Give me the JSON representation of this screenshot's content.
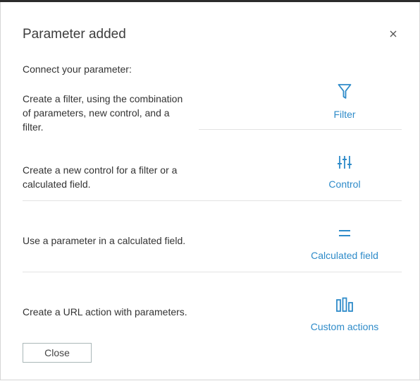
{
  "dialog": {
    "title": "Parameter added",
    "close_icon": "close-icon",
    "subtitle": "Connect your parameter:",
    "close_button_label": "Close"
  },
  "options": [
    {
      "description": "Create a filter, using the combination of parameters, new control, and a filter.",
      "label": "Filter",
      "icon": "filter-icon"
    },
    {
      "description": "Create a new control for a filter or a calculated field.",
      "label": "Control",
      "icon": "sliders-icon"
    },
    {
      "description": "Use a parameter in a calculated field.",
      "label": "Calculated field",
      "icon": "equals-icon"
    },
    {
      "description": "Create a URL action with parameters.",
      "label": "Custom actions",
      "icon": "bar-chart-icon"
    }
  ],
  "colors": {
    "accent": "#2e8bc9",
    "text": "#333333",
    "divider": "#e3e3e3"
  }
}
